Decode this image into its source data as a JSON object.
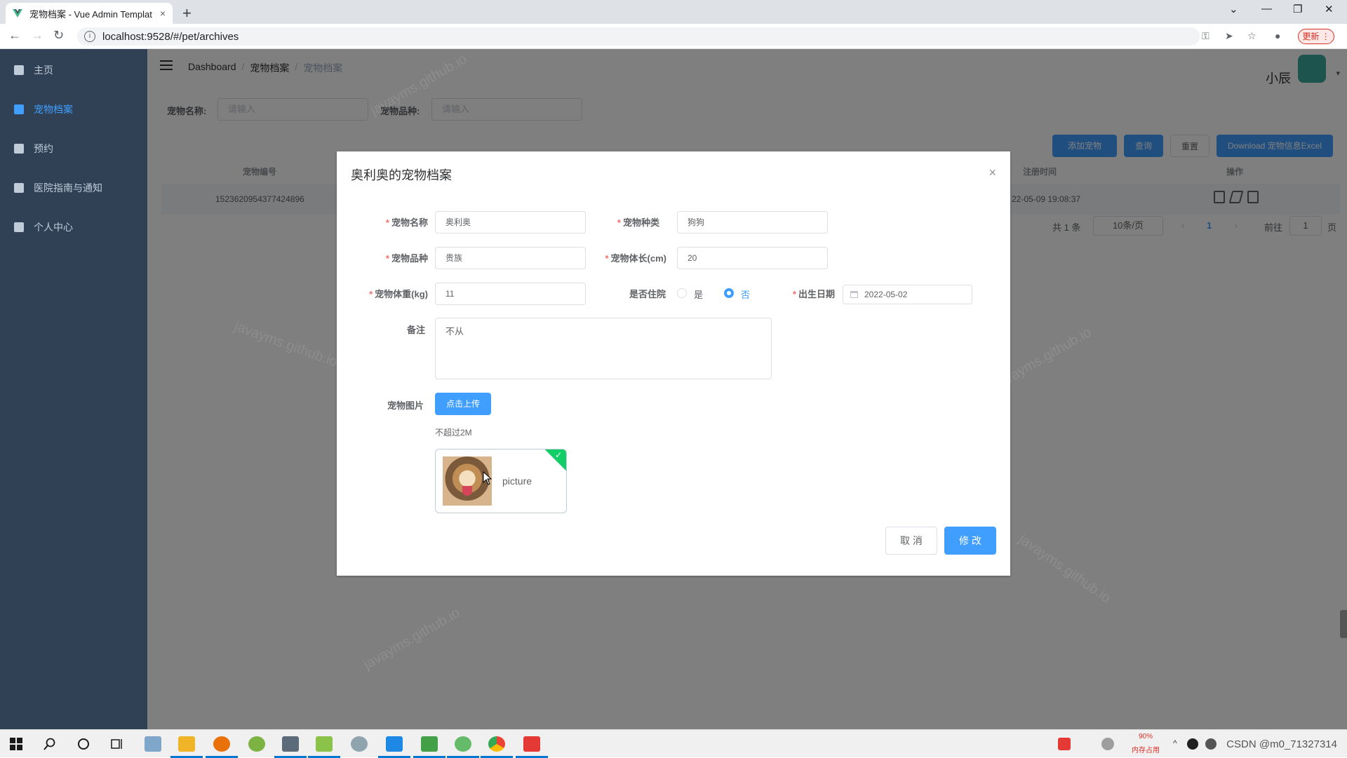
{
  "browser": {
    "tab_title": "宠物档案 - Vue Admin Templat",
    "tab_close": "×",
    "new_tab": "+",
    "url": "localhost:9528/#/pet/archives",
    "update_label": "更新",
    "back": "←",
    "forward": "→",
    "reload": "↻",
    "minimize": "—",
    "restore": "❐",
    "close": "✕",
    "dropdown": "⌄",
    "key_icon": "⚿",
    "send_icon": "➤",
    "star_icon": "☆",
    "profile_icon": "●",
    "menu_icon": "⋮"
  },
  "sidebar": {
    "items": [
      {
        "label": "主页",
        "icon": "home-icon"
      },
      {
        "label": "宠物档案",
        "icon": "briefcase-icon",
        "active": true
      },
      {
        "label": "预约",
        "icon": "document-icon"
      },
      {
        "label": "医院指南与通知",
        "icon": "bell-icon"
      },
      {
        "label": "个人中心",
        "icon": "calendar-icon"
      }
    ]
  },
  "header": {
    "breadcrumb": [
      "Dashboard",
      "宠物档案",
      "宠物档案"
    ],
    "separator": "/",
    "username": "小辰",
    "caret": "▾"
  },
  "filters": {
    "pet_name_label": "宠物名称:",
    "pet_name_placeholder": "请输入",
    "pet_breed_label": "宠物品种:",
    "pet_breed_placeholder": "请输入"
  },
  "toolbar": {
    "add_label": "添加宠物",
    "query_label": "查询",
    "reset_label": "重置",
    "download_label": "Download 宠物信息Excel"
  },
  "table": {
    "headers": {
      "id": "宠物编号",
      "reg_time": "注册时间",
      "ops": "操作"
    },
    "rows": [
      {
        "id": "1523620954377424896",
        "reg_time": "22-05-09 19:08:37"
      }
    ]
  },
  "pagination": {
    "total": "共 1 条",
    "page_size": "10条/页",
    "prev": "‹",
    "current": "1",
    "next": "›",
    "goto_label": "前往",
    "goto_value": "1",
    "page_suffix": "页"
  },
  "dialog": {
    "title": "奥利奥的宠物档案",
    "close": "×",
    "pet_name_label": "宠物名称",
    "pet_name_value": "奥利奥",
    "pet_type_label": "宠物种类",
    "pet_type_value": "狗狗",
    "pet_breed_label": "宠物品种",
    "pet_breed_value": "贵族",
    "pet_length_label": "宠物体长(cm)",
    "pet_length_value": "20",
    "pet_weight_label": "宠物体重(kg)",
    "pet_weight_value": "11",
    "hospitalized_label": "是否住院",
    "yes_label": "是",
    "no_label": "否",
    "hospitalized_selected": "否",
    "birth_label": "出生日期",
    "birth_value": "2022-05-02",
    "remark_label": "备注",
    "remark_value": "不从",
    "picture_label": "宠物图片",
    "upload_label": "点击上传",
    "upload_tip": "不超过2M",
    "file_name": "picture",
    "check": "✓",
    "cancel_label": "取 消",
    "confirm_label": "修 改",
    "required_mark": "*"
  },
  "watermark": "javayms.github.io",
  "taskbar": {
    "tray_percent": "90%",
    "tray_mem": "内存占用",
    "csdn_text": "CSDN @m0_71327314"
  },
  "colors": {
    "primary": "#409eff",
    "sidebar_bg": "#304156",
    "success": "#13ce66",
    "danger": "#f56c6c"
  }
}
